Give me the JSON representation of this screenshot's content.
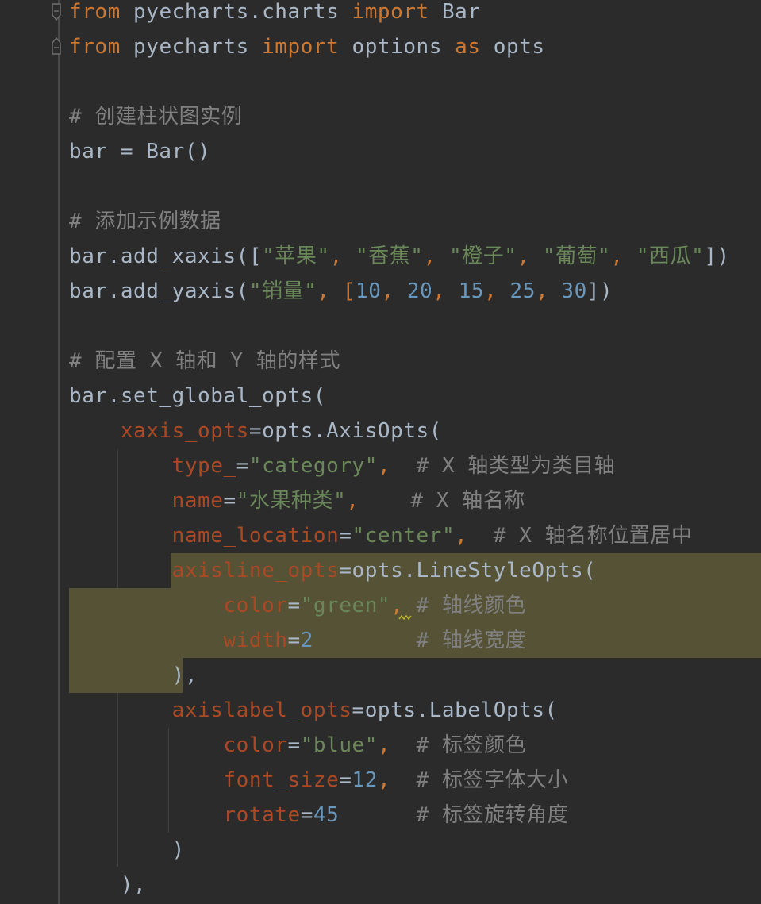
{
  "editor": {
    "line_1": {
      "kw_from": "from",
      "module": " pyecharts.charts ",
      "kw_import": "import",
      "name": " Bar"
    },
    "line_2": {
      "kw_from": "from",
      "module": " pyecharts ",
      "kw_import": "import",
      "mid": " options ",
      "kw_as": "as",
      "alias": " opts"
    },
    "line_4": {
      "comment": "# 创建柱状图实例"
    },
    "line_5": {
      "text": "bar = Bar()"
    },
    "line_7": {
      "comment": "# 添加示例数据"
    },
    "line_8": {
      "prefix": "bar.add_xaxis([",
      "s1": "\"苹果\"",
      "c1": ", ",
      "s2": "\"香蕉\"",
      "c2": ", ",
      "s3": "\"橙子\"",
      "c3": ", ",
      "s4": "\"葡萄\"",
      "c4": ", ",
      "s5": "\"西瓜\"",
      "suffix": "])"
    },
    "line_9": {
      "prefix": "bar.add_yaxis(",
      "s1": "\"销量\"",
      "c1": ", [",
      "n1": "10",
      "c2": ", ",
      "n2": "20",
      "c3": ", ",
      "n3": "15",
      "c4": ", ",
      "n4": "25",
      "c5": ", ",
      "n5": "30",
      "suffix": "])"
    },
    "line_11": {
      "comment": "# 配置 X 轴和 Y 轴的样式"
    },
    "line_12": {
      "text": "bar.set_global_opts("
    },
    "line_13": {
      "indent": "    ",
      "param": "xaxis_opts",
      "rest": "=opts.AxisOpts("
    },
    "line_14": {
      "indent": "        ",
      "param": "type_",
      "eq": "=",
      "str": "\"category\"",
      "comma": ",  ",
      "comment": "# X 轴类型为类目轴"
    },
    "line_15": {
      "indent": "        ",
      "param": "name",
      "eq": "=",
      "str": "\"水果种类\"",
      "comma": ",    ",
      "comment": "# X 轴名称"
    },
    "line_16": {
      "indent": "        ",
      "param": "name_location",
      "eq": "=",
      "str": "\"center\"",
      "comma": ",  ",
      "comment": "# X 轴名称位置居中"
    },
    "line_17": {
      "indent": "        ",
      "param": "axisline_opts",
      "rest": "=opts.LineStyleOpts("
    },
    "line_18": {
      "indent": "            ",
      "param": "color",
      "eq": "=",
      "str": "\"green\"",
      "comma": ", ",
      "comment": "# 轴线颜色"
    },
    "line_19": {
      "indent": "            ",
      "param": "width",
      "eq": "=",
      "num": "2",
      "pad": "        ",
      "comment": "# 轴线宽度"
    },
    "line_20": {
      "indent": "        ",
      "text": "),"
    },
    "line_21": {
      "indent": "        ",
      "param": "axislabel_opts",
      "rest": "=opts.LabelOpts("
    },
    "line_22": {
      "indent": "            ",
      "param": "color",
      "eq": "=",
      "str": "\"blue\"",
      "comma": ",  ",
      "comment": "# 标签颜色"
    },
    "line_23": {
      "indent": "            ",
      "param": "font_size",
      "eq": "=",
      "num": "12",
      "comma": ",  ",
      "comment": "# 标签字体大小"
    },
    "line_24": {
      "indent": "            ",
      "param": "rotate",
      "eq": "=",
      "num": "45",
      "pad": "      ",
      "comment": "# 标签旋转角度"
    },
    "line_25": {
      "indent": "        ",
      "text": ")"
    },
    "line_26": {
      "indent": "    ",
      "text": "),"
    }
  },
  "colors": {
    "background": "#2b2b2b",
    "keyword": "#cc7832",
    "string": "#6a8759",
    "number": "#6897bb",
    "comment": "#808080",
    "parameter": "#aa4926",
    "text": "#a9b7c6",
    "highlight": "#565236"
  },
  "icons": [
    "fold-start-icon",
    "fold-start-icon",
    "warning-squiggle-icon"
  ]
}
